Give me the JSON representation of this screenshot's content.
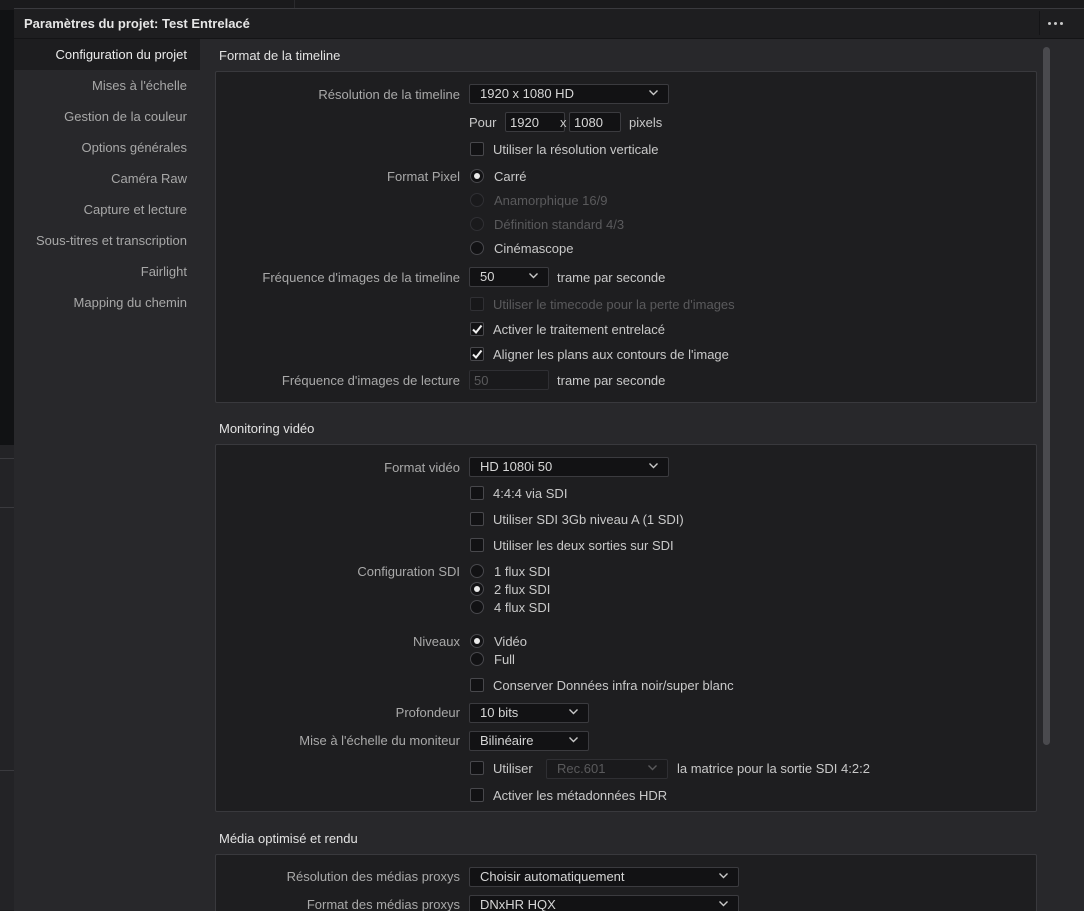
{
  "window": {
    "title": "Paramètres du projet:  Test Entrelacé"
  },
  "sidebar": {
    "items": [
      {
        "label": "Configuration du projet"
      },
      {
        "label": "Mises à l'échelle"
      },
      {
        "label": "Gestion de la couleur"
      },
      {
        "label": "Options générales"
      },
      {
        "label": "Caméra Raw"
      },
      {
        "label": "Capture et lecture"
      },
      {
        "label": "Sous-titres et transcription"
      },
      {
        "label": "Fairlight"
      },
      {
        "label": "Mapping du chemin"
      }
    ]
  },
  "timeline_format": {
    "title": "Format de la timeline",
    "resolution_label": "Résolution de la timeline",
    "resolution_value": "1920 x 1080 HD",
    "for_label": "Pour",
    "width": "1920",
    "x_label": "x",
    "height": "1080",
    "pixels_label": "pixels",
    "vertical_res_label": "Utiliser la résolution verticale",
    "pixel_format_label": "Format Pixel",
    "pixel_options": [
      "Carré",
      "Anamorphique 16/9",
      "Définition standard 4/3",
      "Cinémascope"
    ],
    "framerate_label": "Fréquence d'images de la timeline",
    "framerate_value": "50",
    "fps_unit": "trame par seconde",
    "dropframe_label": "Utiliser le timecode pour la perte d'images",
    "interlace_label": "Activer le traitement entrelacé",
    "align_label": "Aligner les plans aux contours de l'image",
    "playback_label": "Fréquence d'images de lecture",
    "playback_value": "50",
    "playback_unit": "trame par seconde"
  },
  "video_monitoring": {
    "title": "Monitoring vidéo",
    "format_label": "Format vidéo",
    "format_value": "HD 1080i 50",
    "opt_444": "4:4:4 via SDI",
    "opt_3gb": "Utiliser SDI 3Gb niveau A (1 SDI)",
    "opt_both": "Utiliser les deux sorties sur SDI",
    "sdi_label": "Configuration SDI",
    "sdi_options": [
      "1 flux SDI",
      "2 flux SDI",
      "4 flux SDI"
    ],
    "levels_label": "Niveaux",
    "levels_options": [
      "Vidéo",
      "Full"
    ],
    "preserve_label": "Conserver Données infra noir/super blanc",
    "depth_label": "Profondeur",
    "depth_value": "10 bits",
    "scale_label": "Mise à l'échelle du moniteur",
    "scale_value": "Bilinéaire",
    "use_label": "Utiliser",
    "matrix_value": "Rec.601",
    "matrix_suffix": "la matrice pour la sortie SDI 4:2:2",
    "hdr_label": "Activer les métadonnées HDR"
  },
  "optimized_media": {
    "title": "Média optimisé et rendu",
    "proxy_res_label": "Résolution des médias proxys",
    "proxy_res_value": "Choisir automatiquement",
    "proxy_format_label": "Format des médias proxys",
    "proxy_format_value": "DNxHR HQX"
  }
}
